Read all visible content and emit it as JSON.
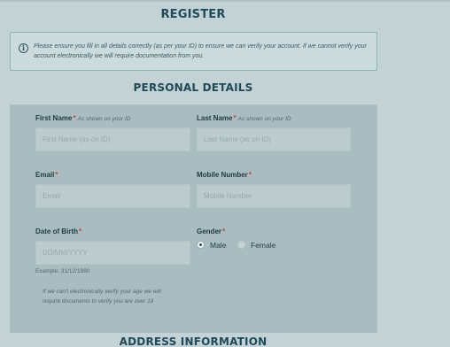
{
  "page": {
    "title": "REGISTER",
    "info": "Please ensure you fill in all details correctly (as per your ID) to ensure we can verify your account. If we cannot verify your account electronically we will require documentation from you.",
    "personal_heading": "PERSONAL DETAILS",
    "address_heading": "ADDRESS INFORMATION"
  },
  "form": {
    "first_name": {
      "label": "First Name",
      "required": "*",
      "hint": "As shown on your ID",
      "placeholder": "First Name (as on ID)",
      "value": ""
    },
    "last_name": {
      "label": "Last Name",
      "required": "*",
      "hint": "As shown on your ID",
      "placeholder": "Last Name (as on ID)",
      "value": ""
    },
    "email": {
      "label": "Email",
      "required": "*",
      "placeholder": "Email",
      "value": ""
    },
    "mobile": {
      "label": "Mobile Number",
      "required": "*",
      "placeholder": "Mobile Number",
      "value": ""
    },
    "dob": {
      "label": "Date of Birth",
      "required": "*",
      "placeholder": "DD/MM/YYYY",
      "value": "",
      "example": "Example: 31/12/1990",
      "note": "If we can't electronically verify your age we will require documents to verify you are over 18"
    },
    "gender": {
      "label": "Gender",
      "required": "*",
      "options": [
        "Male",
        "Female"
      ],
      "selected": "Male"
    }
  },
  "colors": {
    "background": "#c3d2d4",
    "panel": "#a9bcbf",
    "heading": "#1e4a5a",
    "required": "#d43a3a"
  }
}
